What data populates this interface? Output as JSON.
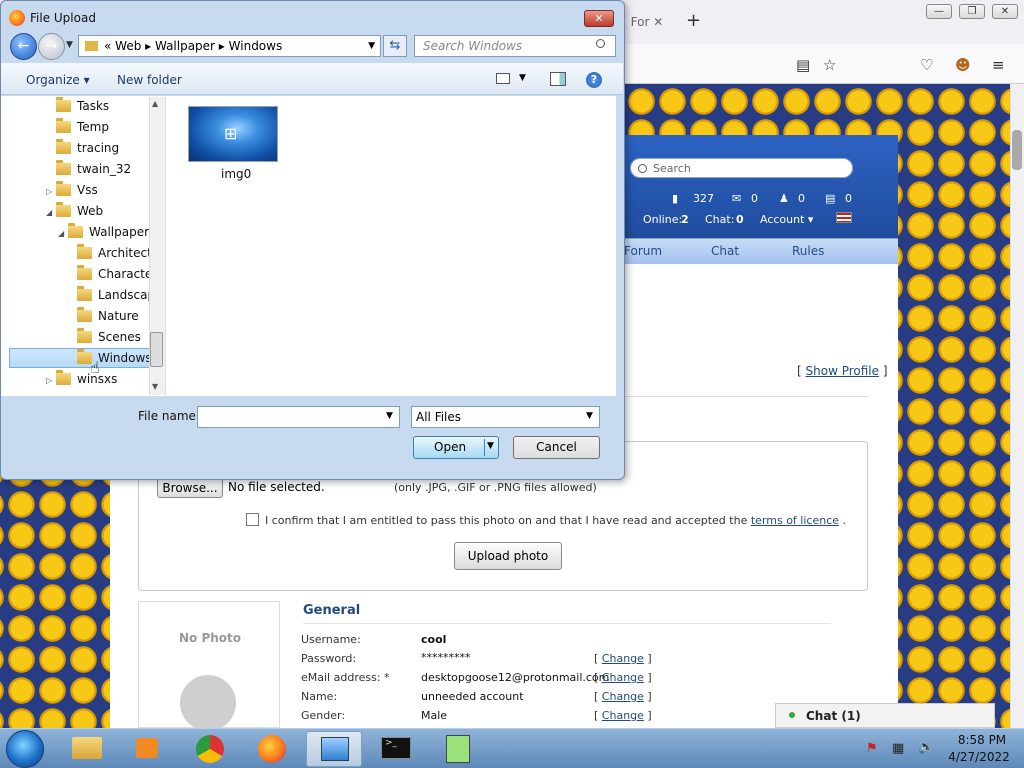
{
  "browser": {
    "tab_title": "! For",
    "window_buttons": [
      "—",
      "❐",
      "✕"
    ]
  },
  "site": {
    "search_placeholder": "Search",
    "stats": {
      "coins": "327",
      "messages": "0",
      "friends": "0",
      "notes": "0"
    },
    "online_label": "Online:",
    "online_count": "2",
    "chat_label": "Chat:",
    "chat_count": "0",
    "account_label": "Account ▾",
    "nav": [
      "Forum",
      "Chat",
      "Rules"
    ],
    "show_profile": "Show Profile",
    "upload": {
      "browse_label": "Browse...",
      "no_file": "No file selected.",
      "allowed": "(only .JPG, .GIF or .PNG files allowed)",
      "confirm_text": "I confirm that I am entitled to pass this photo on and that I have read and accepted the",
      "terms_link": "terms of licence",
      "confirm_end": ".",
      "upload_button": "Upload photo"
    },
    "no_photo": "No Photo",
    "general_heading": "General",
    "fields": [
      {
        "label": "Username:",
        "value": "cool",
        "change": ""
      },
      {
        "label": "Password:",
        "value": "*********",
        "change": "Change"
      },
      {
        "label": "eMail address: *",
        "value": "desktopgoose12@protonmail.com",
        "change": "Change"
      },
      {
        "label": "Name:",
        "value": "unneeded account",
        "change": "Change"
      },
      {
        "label": "Gender:",
        "value": "Male",
        "change": "Change"
      }
    ],
    "chat_bar": "Chat (1)"
  },
  "dialog": {
    "title": "File Upload",
    "breadcrumb": "«  Web  ▸  Wallpaper  ▸  Windows",
    "search_placeholder": "Search Windows",
    "organize": "Organize ▾",
    "new_folder": "New folder",
    "tree": [
      {
        "label": "Tasks",
        "indent": 0,
        "exp": ""
      },
      {
        "label": "Temp",
        "indent": 0,
        "exp": ""
      },
      {
        "label": "tracing",
        "indent": 0,
        "exp": ""
      },
      {
        "label": "twain_32",
        "indent": 0,
        "exp": ""
      },
      {
        "label": "Vss",
        "indent": 0,
        "exp": "▷"
      },
      {
        "label": "Web",
        "indent": 0,
        "exp": "◢"
      },
      {
        "label": "Wallpaper",
        "indent": 1,
        "exp": "◢"
      },
      {
        "label": "Architect",
        "indent": 2,
        "exp": ""
      },
      {
        "label": "Character",
        "indent": 2,
        "exp": ""
      },
      {
        "label": "Landscap",
        "indent": 2,
        "exp": ""
      },
      {
        "label": "Nature",
        "indent": 2,
        "exp": ""
      },
      {
        "label": "Scenes",
        "indent": 2,
        "exp": ""
      },
      {
        "label": "Windows",
        "indent": 2,
        "exp": ""
      },
      {
        "label": "winsxs",
        "indent": 0,
        "exp": "▷"
      }
    ],
    "file_item": "img0",
    "file_name_label": "File name:",
    "file_name_value": "",
    "file_type": "All Files",
    "open_label": "Open",
    "cancel_label": "Cancel"
  },
  "taskbar": {
    "time": "8:58 PM",
    "date": "4/27/2022"
  }
}
